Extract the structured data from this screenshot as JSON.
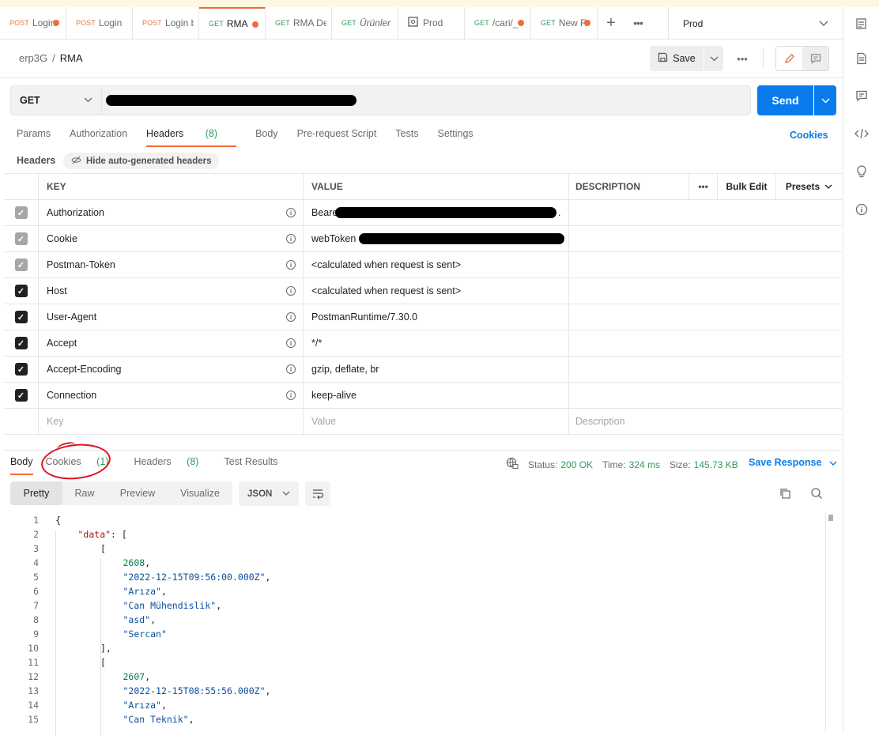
{
  "tabs": [
    {
      "method": "POST",
      "title": "Login",
      "unsaved": true,
      "active": false
    },
    {
      "method": "POST",
      "title": "Login",
      "unsaved": false,
      "active": false
    },
    {
      "method": "POST",
      "title": "Login b",
      "unsaved": false,
      "active": false
    },
    {
      "method": "GET",
      "title": "RMA",
      "unsaved": true,
      "active": true
    },
    {
      "method": "GET",
      "title": "RMA Det",
      "unsaved": false,
      "active": false
    },
    {
      "method": "GET",
      "title": "Ürünler",
      "unsaved": false,
      "active": false
    },
    {
      "method": "",
      "title": "Prod",
      "unsaved": false,
      "active": false
    },
    {
      "method": "GET",
      "title": "/cari/_",
      "unsaved": true,
      "active": false
    },
    {
      "method": "GET",
      "title": "New R",
      "unsaved": true,
      "active": false
    }
  ],
  "environment": "Prod",
  "breadcrumb": {
    "workspace": "erp3G",
    "separator": "/",
    "request": "RMA"
  },
  "actions": {
    "save": "Save",
    "send": "Send"
  },
  "request": {
    "method": "GET"
  },
  "request_tabs": {
    "params": "Params",
    "authorization": "Authorization",
    "headers": "Headers",
    "headers_count": "(8)",
    "body": "Body",
    "prerequest": "Pre-request Script",
    "tests": "Tests",
    "settings": "Settings",
    "cookies": "Cookies"
  },
  "headers_section": {
    "title": "Headers",
    "hide_auto": "Hide auto-generated headers"
  },
  "table": {
    "columns": {
      "key": "KEY",
      "value": "VALUE",
      "description": "DESCRIPTION",
      "bulk_edit": "Bulk Edit",
      "presets": "Presets"
    },
    "rows": [
      {
        "key": "Authorization",
        "value": "Bearer",
        "value_suffix": ".",
        "auto": true
      },
      {
        "key": "Cookie",
        "value": "webToken",
        "value_suffix": "",
        "auto": true
      },
      {
        "key": "Postman-Token",
        "value": "<calculated when request is sent>",
        "value_suffix": "",
        "auto": true
      },
      {
        "key": "Host",
        "value": "<calculated when request is sent>",
        "value_suffix": "",
        "auto": false
      },
      {
        "key": "User-Agent",
        "value": "PostmanRuntime/7.30.0",
        "value_suffix": "",
        "auto": false
      },
      {
        "key": "Accept",
        "value": "*/*",
        "value_suffix": "",
        "auto": false
      },
      {
        "key": "Accept-Encoding",
        "value": "gzip, deflate, br",
        "value_suffix": "",
        "auto": false
      },
      {
        "key": "Connection",
        "value": "keep-alive",
        "value_suffix": "",
        "auto": false
      }
    ],
    "placeholders": {
      "key": "Key",
      "value": "Value",
      "description": "Description"
    }
  },
  "response": {
    "tabs": {
      "body": "Body",
      "cookies": "Cookies",
      "cookies_count": "(1)",
      "headers": "Headers",
      "headers_count": "(8)",
      "test_results": "Test Results"
    },
    "status_label": "Status:",
    "status_value": "200 OK",
    "time_label": "Time:",
    "time_value": "324 ms",
    "size_label": "Size:",
    "size_value": "145.73 KB",
    "save_response": "Save Response",
    "views": [
      "Pretty",
      "Raw",
      "Preview",
      "Visualize"
    ],
    "format": "JSON"
  },
  "code_lines": [
    {
      "n": "1",
      "indent": 0,
      "parts": [
        [
          "p",
          "{"
        ]
      ]
    },
    {
      "n": "2",
      "indent": 1,
      "parts": [
        [
          "k",
          "\"data\""
        ],
        [
          "p",
          ": ["
        ]
      ]
    },
    {
      "n": "3",
      "indent": 2,
      "parts": [
        [
          "p",
          "["
        ]
      ]
    },
    {
      "n": "4",
      "indent": 3,
      "parts": [
        [
          "n",
          "2608"
        ],
        [
          "p",
          ","
        ]
      ]
    },
    {
      "n": "5",
      "indent": 3,
      "parts": [
        [
          "s",
          "\"2022-12-15T09:56:00.000Z\""
        ],
        [
          "p",
          ","
        ]
      ]
    },
    {
      "n": "6",
      "indent": 3,
      "parts": [
        [
          "s",
          "\"Arıza\""
        ],
        [
          "p",
          ","
        ]
      ]
    },
    {
      "n": "7",
      "indent": 3,
      "parts": [
        [
          "s",
          "\"Can Mühendislik\""
        ],
        [
          "p",
          ","
        ]
      ]
    },
    {
      "n": "8",
      "indent": 3,
      "parts": [
        [
          "s",
          "\"asd\""
        ],
        [
          "p",
          ","
        ]
      ]
    },
    {
      "n": "9",
      "indent": 3,
      "parts": [
        [
          "s",
          "\"Sercan\""
        ]
      ]
    },
    {
      "n": "10",
      "indent": 2,
      "parts": [
        [
          "p",
          "],"
        ]
      ]
    },
    {
      "n": "11",
      "indent": 2,
      "parts": [
        [
          "p",
          "["
        ]
      ]
    },
    {
      "n": "12",
      "indent": 3,
      "parts": [
        [
          "n",
          "2607"
        ],
        [
          "p",
          ","
        ]
      ]
    },
    {
      "n": "13",
      "indent": 3,
      "parts": [
        [
          "s",
          "\"2022-12-15T08:55:56.000Z\""
        ],
        [
          "p",
          ","
        ]
      ]
    },
    {
      "n": "14",
      "indent": 3,
      "parts": [
        [
          "s",
          "\"Arıza\""
        ],
        [
          "p",
          ","
        ]
      ]
    },
    {
      "n": "15",
      "indent": 3,
      "parts": [
        [
          "s",
          "\"Can Teknik\""
        ],
        [
          "p",
          ","
        ]
      ]
    }
  ],
  "colors": {
    "accent": "#f26b3a",
    "primary": "#097bed",
    "success": "#2f9b5a",
    "annotation": "#e0141e"
  }
}
